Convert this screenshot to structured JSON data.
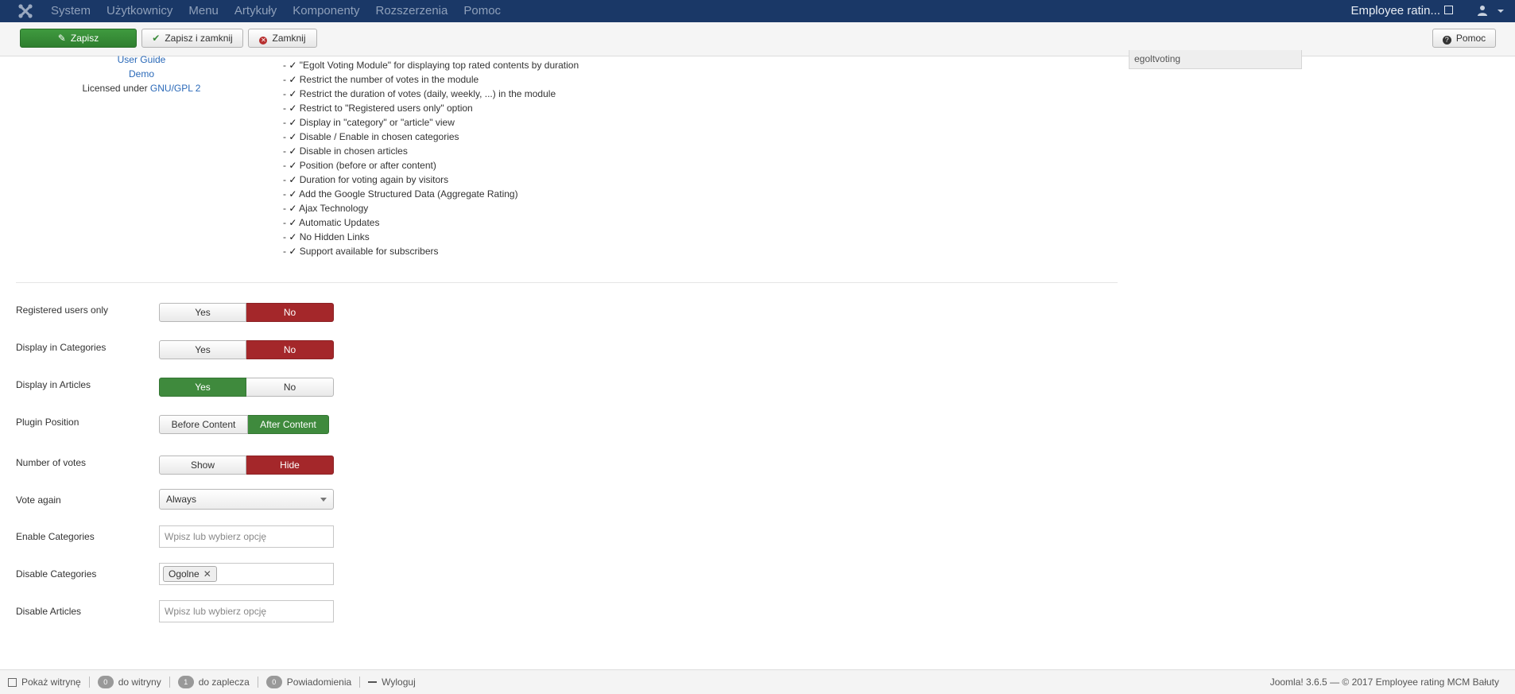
{
  "topnav": {
    "menu": [
      "System",
      "Użytkownicy",
      "Menu",
      "Artykuły",
      "Komponenty",
      "Rozszerzenia",
      "Pomoc"
    ],
    "site_name": "Employee ratin..."
  },
  "toolbar": {
    "save": "Zapisz",
    "save_close": "Zapisz i zamknij",
    "close": "Zamknij",
    "help": "Pomoc"
  },
  "info": {
    "user_guide": "User Guide",
    "demo": "Demo",
    "licensed_prefix": "Licensed under ",
    "license_link": "GNU/GPL 2"
  },
  "features": [
    "\"Egolt Voting Module\" for displaying top rated contents by duration",
    "Restrict the number of votes in the module",
    "Restrict the duration of votes (daily, weekly, ...) in the module",
    "Restrict to \"Registered users only\" option",
    "Display in \"category\" or \"article\" view",
    "Disable / Enable in chosen categories",
    "Disable in chosen articles",
    "Position (before or after content)",
    "Duration for voting again by visitors",
    "Add the Google Structured Data (Aggregate Rating)",
    "Ajax Technology",
    "Automatic Updates",
    "No Hidden Links",
    "Support available for subscribers"
  ],
  "side_field_value": "egoltvoting",
  "form": {
    "registered_only": {
      "label": "Registered users only",
      "yes": "Yes",
      "no": "No",
      "selected": "No"
    },
    "display_categories": {
      "label": "Display in Categories",
      "yes": "Yes",
      "no": "No",
      "selected": "No"
    },
    "display_articles": {
      "label": "Display in Articles",
      "yes": "Yes",
      "no": "No",
      "selected": "Yes"
    },
    "plugin_position": {
      "label": "Plugin Position",
      "before": "Before Content",
      "after": "After Content",
      "selected": "After Content"
    },
    "number_of_votes": {
      "label": "Number of votes",
      "show": "Show",
      "hide": "Hide",
      "selected": "Hide"
    },
    "vote_again": {
      "label": "Vote again",
      "value": "Always"
    },
    "enable_categories": {
      "label": "Enable Categories",
      "placeholder": "Wpisz lub wybierz opcję"
    },
    "disable_categories": {
      "label": "Disable Categories",
      "tag": "Ogolne"
    },
    "disable_articles": {
      "label": "Disable Articles",
      "placeholder": "Wpisz lub wybierz opcję"
    }
  },
  "footer": {
    "view_site": "Pokaż witrynę",
    "visitors_count": "0",
    "visitors_label": "do witryny",
    "admins_count": "1",
    "admins_label": "do zaplecza",
    "messages_count": "0",
    "messages_label": "Powiadomienia",
    "logout": "Wyloguj",
    "version": "Joomla! 3.6.5 — © 2017 Employee rating MCM Bałuty"
  },
  "colors": {
    "navbar": "#1a3867",
    "save_green": "#3f9a3f",
    "toggle_red": "#a4272a",
    "toggle_green": "#3f8a3d",
    "link": "#2a69b8"
  }
}
